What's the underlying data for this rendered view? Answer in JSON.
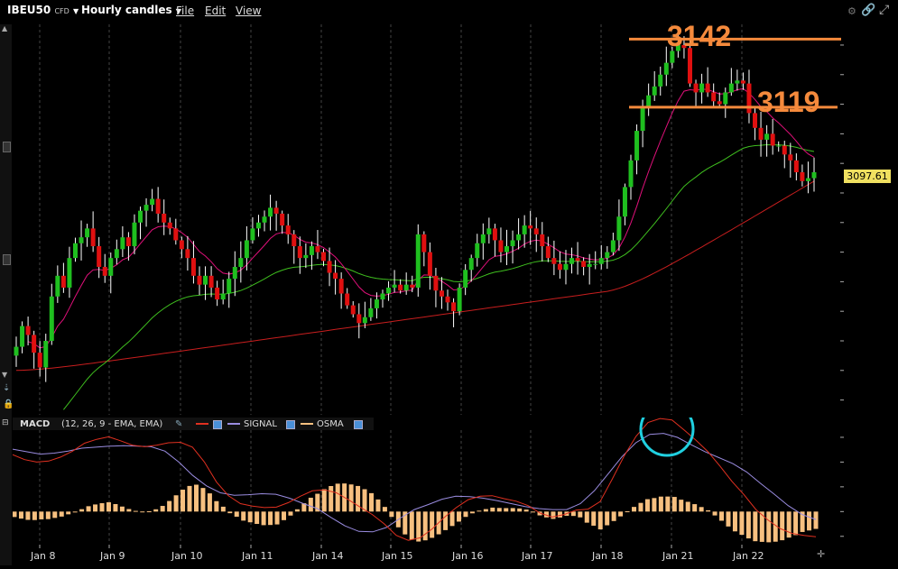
{
  "toolbar": {
    "symbol": "IBEU50",
    "symbol_suffix": "CFD",
    "interval": "Hourly candles",
    "menu_file": "File",
    "menu_edit": "Edit",
    "menu_view": "View"
  },
  "colors": {
    "up": "#1fbf1f",
    "down": "#e01010",
    "ema_fast": "#e0107a",
    "ema_mid": "#3fbf1f",
    "ema_slow": "#c81e1e",
    "macd_line": "#e03020",
    "signal_line": "#9a8ce0",
    "osma": "#f7c080",
    "annotation": "#f58a3c",
    "circle": "#20d0e0"
  },
  "annotations": {
    "level_high": "3142",
    "level_low": "3119"
  },
  "price_panel": {
    "last_price": "3097.61"
  },
  "macd_legend": {
    "name": "MACD",
    "params": "(12, 26, 9 - EMA, EMA)",
    "signal_label": "SIGNAL",
    "osma_label": "OSMA"
  },
  "chart_data": [
    {
      "type": "candlestick",
      "ylim": [
        3015,
        3147
      ],
      "y_ticks": [
        3020,
        3030,
        3040,
        3050,
        3060,
        3070,
        3080,
        3090,
        3100,
        3110,
        3120,
        3130,
        3140
      ],
      "x_labels": [
        "Jan 8",
        "Jan 9",
        "Jan 10",
        "Jan 11",
        "Jan 14",
        "Jan 15",
        "Jan 16",
        "Jan 17",
        "Jan 18",
        "Jan 21",
        "Jan 22"
      ],
      "levels": [
        3142,
        3119
      ],
      "last_price": 3097.61,
      "candles_close": [
        3038,
        3045,
        3042,
        3036,
        3031,
        3040,
        3055,
        3062,
        3058,
        3068,
        3073,
        3075,
        3078,
        3072,
        3065,
        3062,
        3068,
        3071,
        3075,
        3072,
        3080,
        3084,
        3086,
        3088,
        3083,
        3080,
        3078,
        3074,
        3071,
        3068,
        3062,
        3059,
        3062,
        3058,
        3054,
        3056,
        3061,
        3065,
        3068,
        3074,
        3078,
        3080,
        3082,
        3085,
        3083,
        3079,
        3076,
        3072,
        3068,
        3069,
        3072,
        3070,
        3067,
        3063,
        3061,
        3056,
        3052,
        3049,
        3046,
        3048,
        3051,
        3054,
        3056,
        3058,
        3059,
        3057,
        3059,
        3058,
        3076,
        3070,
        3062,
        3057,
        3055,
        3053,
        3050,
        3058,
        3064,
        3068,
        3073,
        3076,
        3078,
        3074,
        3070,
        3072,
        3074,
        3076,
        3079,
        3078,
        3076,
        3072,
        3068,
        3066,
        3064,
        3066,
        3068,
        3067,
        3065,
        3066,
        3066,
        3068,
        3070,
        3074,
        3082,
        3092,
        3101,
        3111,
        3119,
        3123,
        3126,
        3130,
        3134,
        3138,
        3140,
        3139,
        3127,
        3124,
        3127,
        3124,
        3121,
        3120,
        3124,
        3127,
        3128,
        3127,
        3117,
        3112,
        3108,
        3110,
        3106,
        3106,
        3103,
        3101,
        3097,
        3094,
        3095,
        3097
      ]
    },
    {
      "type": "macd",
      "ylim": [
        -6.5,
        19
      ],
      "y_ticks": [
        -5,
        0,
        5,
        10,
        15
      ],
      "macd": [
        11.5,
        10.5,
        10,
        10.2,
        11,
        12.2,
        13.8,
        14.6,
        15.1,
        14.3,
        13.4,
        13.1,
        13.4,
        13.9,
        14,
        13,
        10,
        6,
        3.2,
        1.6,
        1.1,
        0.8,
        0.9,
        1.8,
        3.1,
        4.2,
        4.4,
        3.8,
        2.4,
        0.9,
        -0.6,
        -2.5,
        -4.8,
        -5.8,
        -5.3,
        -3.5,
        -1.2,
        0.8,
        2.4,
        3.1,
        3.2,
        2.6,
        2.1,
        1.2,
        -0.3,
        -1.1,
        -0.6,
        0.3,
        0.5,
        2,
        6.5,
        11.2,
        15.2,
        18,
        18.8,
        18.5,
        16.5,
        14.4,
        12.1,
        9.2,
        6.1,
        3.4,
        0.4,
        -1.7,
        -3.4,
        -4.4,
        -4.8,
        -5.1
      ],
      "signal": [
        12.6,
        12.1,
        11.6,
        11.8,
        12.2,
        12.8,
        13,
        13.2,
        13.3,
        13.2,
        13.1,
        12.2,
        10,
        7.3,
        5.2,
        3.8,
        3.3,
        3.4,
        3.6,
        3.5,
        2.7,
        1.6,
        0.6,
        -1.2,
        -2.9,
        -4,
        -4.1,
        -3.2,
        -1.3,
        0.4,
        1.4,
        2.5,
        3.1,
        3,
        2.7,
        2.2,
        1.6,
        1,
        0.6,
        0.4,
        0.4,
        1.6,
        4.2,
        7.6,
        11.1,
        13.9,
        15.6,
        15.8,
        15,
        13.5,
        12.1,
        10.9,
        9.7,
        8,
        5.7,
        3.5,
        1.2,
        -0.6,
        -1.6
      ]
    }
  ]
}
